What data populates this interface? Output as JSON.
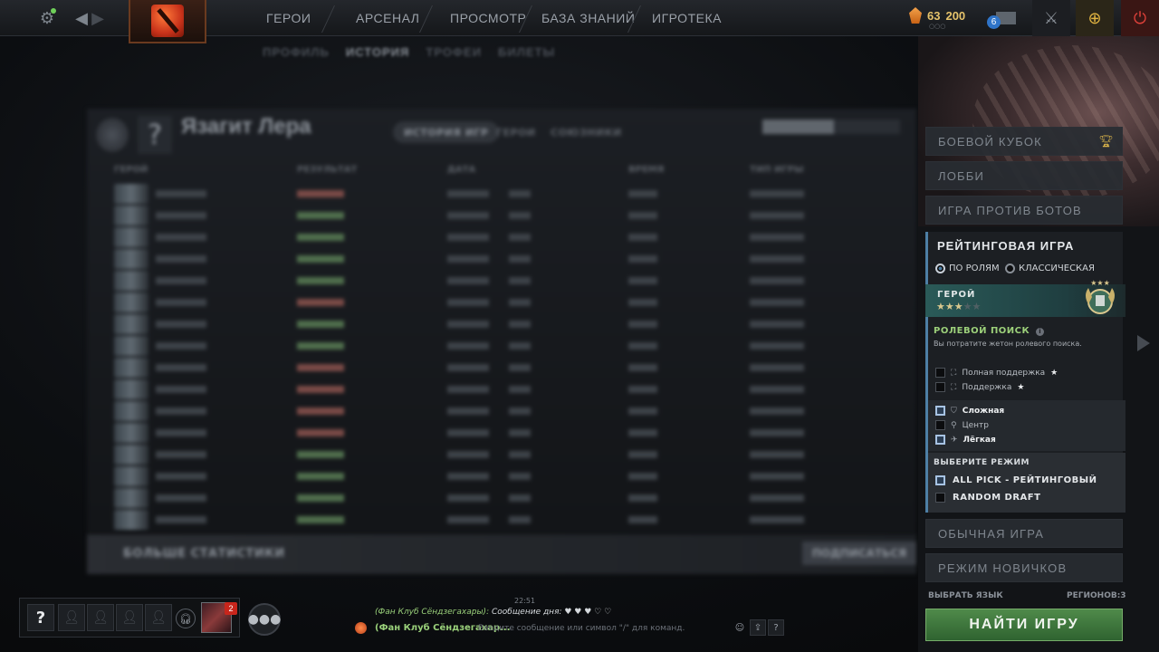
{
  "topbar": {
    "nav": [
      "ГЕРОИ",
      "АРСЕНАЛ",
      "ПРОСМОТР",
      "БАЗА ЗНАНИЙ",
      "ИГРОТЕКА"
    ],
    "shards": "63",
    "plus_level": "200",
    "mail_count": "6"
  },
  "profile_tabs": [
    "ПРОФИЛЬ",
    "ИСТОРИЯ",
    "ТРОФЕИ",
    "БИЛЕТЫ"
  ],
  "history": {
    "player_name": "Язагит Лера",
    "tabs": [
      "ИСТОРИЯ ИГР",
      "ГЕРОИ",
      "СОЮЗНИКИ"
    ],
    "columns": [
      "ГЕРОЙ",
      "РЕЗУЛЬТАТ",
      "ДАТА",
      "ВРЕМЯ",
      "ТИП ИГРЫ"
    ],
    "rows": [
      {
        "res": "l"
      },
      {
        "res": "w"
      },
      {
        "res": "w"
      },
      {
        "res": "w"
      },
      {
        "res": "w"
      },
      {
        "res": "l"
      },
      {
        "res": "w"
      },
      {
        "res": "w"
      },
      {
        "res": "l"
      },
      {
        "res": "l"
      },
      {
        "res": "l"
      },
      {
        "res": "l"
      },
      {
        "res": "w"
      },
      {
        "res": "w"
      },
      {
        "res": "w"
      },
      {
        "res": "w"
      }
    ]
  },
  "more_stats": {
    "title": "БОЛЬШЕ СТАТИСТИКИ",
    "button": "ПОДПИСАТЬСЯ"
  },
  "modes": {
    "battle_cup": "БОЕВОЙ КУБОК",
    "lobby": "ЛОББИ",
    "bots": "ИГРА ПРОТИВ БОТОВ",
    "ranked": "РЕЙТИНГОВАЯ ИГРА",
    "normal": "ОБЫЧНАЯ ИГРА",
    "newbie": "РЕЖИМ НОВИЧКОВ"
  },
  "ranked": {
    "by_role": "ПО РОЛЯМ",
    "classic": "КЛАССИЧЕСКАЯ",
    "rank_name": "ГЕРОЙ",
    "rank_stars": 3,
    "rank_stars_max": 5,
    "role_search_title": "РОЛЕВОЙ ПОИСК",
    "role_search_desc": "Вы потратите жетон ролевого поиска.",
    "roles": [
      {
        "label": "Полная поддержка",
        "checked": false,
        "star": true
      },
      {
        "label": "Поддержка",
        "checked": false,
        "star": true
      },
      {
        "label": "Сложная",
        "checked": true,
        "star": false
      },
      {
        "label": "Центр",
        "checked": false,
        "star": false
      },
      {
        "label": "Лёгкая",
        "checked": true,
        "star": false
      }
    ],
    "choose_mode": "ВЫБЕРИТЕ РЕЖИМ",
    "game_modes": [
      {
        "label": "ALL PICK - РЕЙТИНГОВЫЙ",
        "checked": true
      },
      {
        "label": "RANDOM DRAFT",
        "checked": false
      }
    ]
  },
  "footer_right": {
    "language": "ВЫБРАТЬ ЯЗЫК",
    "regions": "РЕГИОНОВ:3",
    "find_game": "НАЙТИ ИГРУ"
  },
  "party": {
    "me": "?",
    "friend_badge": "2"
  },
  "chat": {
    "time": "22:51",
    "message_prefix": "(Фан Клуб Сёндзегахары): ",
    "message_text": "Сообщение дня: ♥ ♥ ♥ ♡ ♡",
    "channel": "(Фан Клуб Сёндзегахар...",
    "placeholder": "Введите сообщение или символ \"/\" для команд."
  }
}
